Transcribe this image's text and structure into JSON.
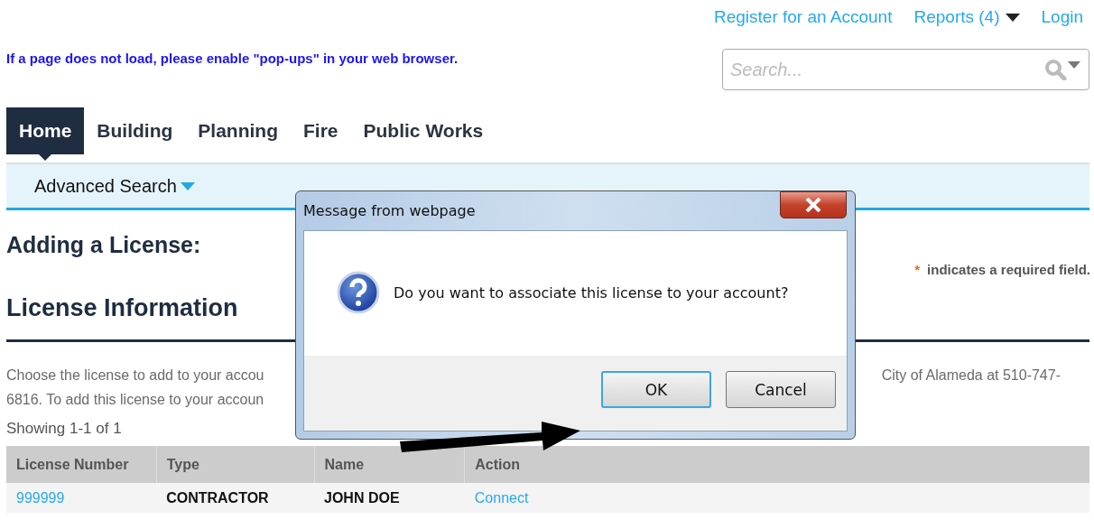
{
  "top_links": [
    {
      "label": "Register for an Account",
      "kind": "link"
    },
    {
      "label": "Reports (4)",
      "kind": "menu"
    },
    {
      "label": "Login",
      "kind": "link"
    }
  ],
  "notice": "If a page does not load, please enable \"pop-ups\" in your web browser.",
  "search": {
    "placeholder": "Search..."
  },
  "nav_tabs": [
    {
      "label": "Home",
      "selected": true
    },
    {
      "label": "Building",
      "selected": false
    },
    {
      "label": "Planning",
      "selected": false
    },
    {
      "label": "Fire",
      "selected": false
    },
    {
      "label": "Public Works",
      "selected": false
    }
  ],
  "sub_nav": {
    "label": "Advanced Search"
  },
  "page_title": "Adding a License:",
  "required_note": {
    "marker": "*",
    "text": "indicates a required field."
  },
  "section_title": "License Information",
  "instructions": {
    "line_1_start": "Choose the license to add to your accou",
    "line_1_end": "City of Alameda at 510-747-",
    "line_2_start": "6816. To add this license to your accoun"
  },
  "results_count": "Showing 1-1 of 1",
  "table": {
    "columns": [
      "License Number",
      "Type",
      "Name",
      "Action"
    ],
    "rows": [
      {
        "license_number": "999999",
        "type": "CONTRACTOR",
        "name": "JOHN DOE",
        "action": "Connect"
      }
    ]
  },
  "dialog": {
    "title": "Message from webpage",
    "message": "Do you want to associate this license to your account?",
    "buttons": [
      {
        "label": "OK",
        "focused": true
      },
      {
        "label": "Cancel",
        "focused": false
      }
    ]
  }
}
